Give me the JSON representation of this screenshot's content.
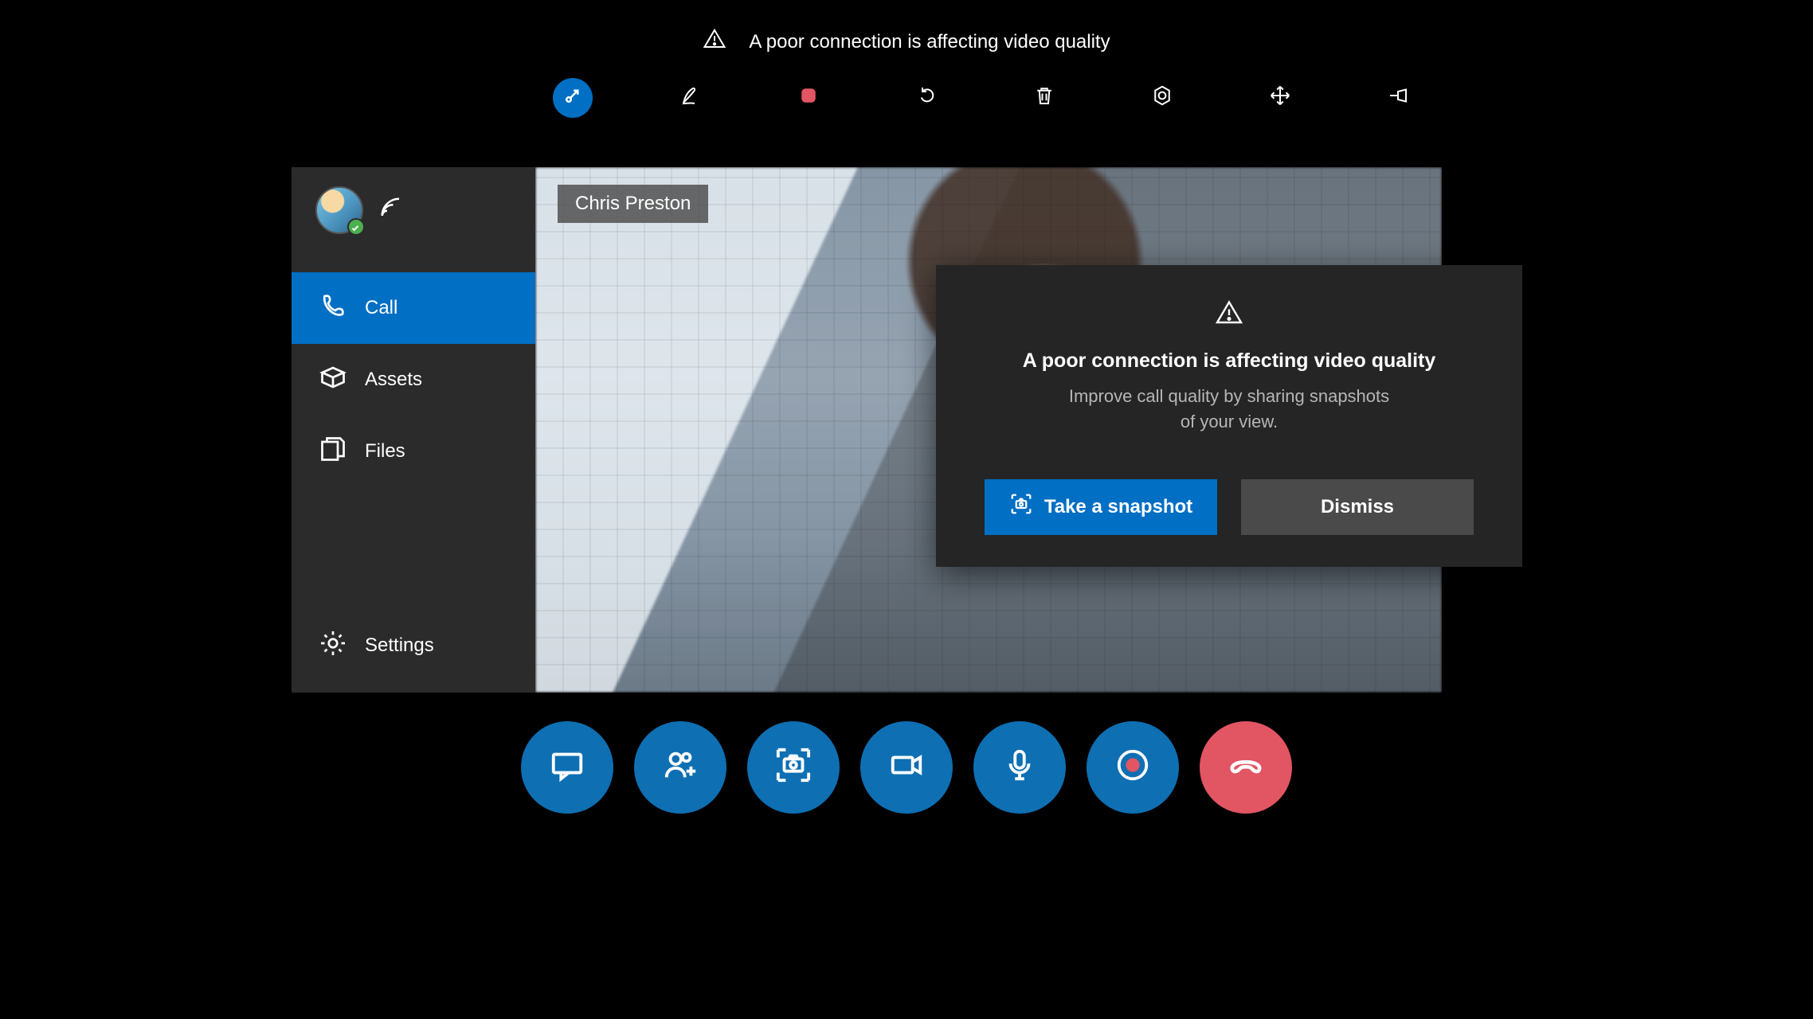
{
  "top_notice": {
    "text": "A poor connection is affecting video quality"
  },
  "toolbar": {
    "items": [
      {
        "name": "minimize-icon"
      },
      {
        "name": "ink-icon"
      },
      {
        "name": "record-stop-icon"
      },
      {
        "name": "undo-icon"
      },
      {
        "name": "trash-icon"
      },
      {
        "name": "camera-settings-icon"
      },
      {
        "name": "move-icon"
      },
      {
        "name": "pin-icon"
      }
    ]
  },
  "sidebar": {
    "items": [
      {
        "label": "Call",
        "icon": "phone-icon",
        "active": true
      },
      {
        "label": "Assets",
        "icon": "box-icon",
        "active": false
      },
      {
        "label": "Files",
        "icon": "files-icon",
        "active": false
      },
      {
        "label": "Settings",
        "icon": "gear-icon",
        "active": false
      }
    ]
  },
  "caller": {
    "name": "Chris Preston"
  },
  "dialog": {
    "title": "A poor connection is affecting video quality",
    "subtitle_line1": "Improve call quality by sharing snapshots",
    "subtitle_line2": "of your view.",
    "primary_label": "Take a snapshot",
    "secondary_label": "Dismiss"
  },
  "controls": {
    "icons": [
      "chat",
      "add-people",
      "snapshot",
      "video",
      "mic",
      "record",
      "hangup"
    ]
  }
}
